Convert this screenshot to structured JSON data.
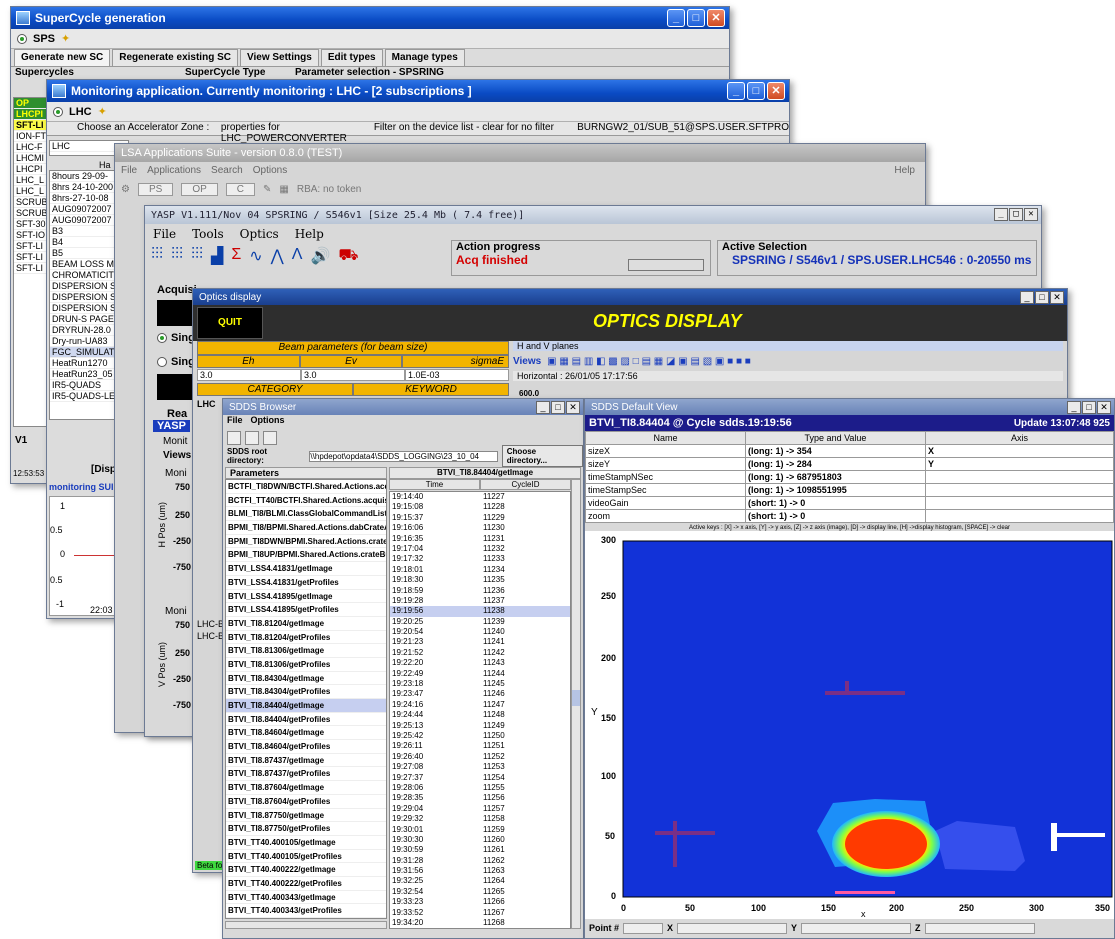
{
  "supercycle": {
    "title": "SuperCycle generation",
    "machine": "SPS",
    "tabs": [
      "Generate new SC",
      "Regenerate existing SC",
      "View Settings",
      "Edit types",
      "Manage types"
    ],
    "col1": "Supercycles",
    "col2": "SuperCycle Type",
    "col3": "Parameter selection - SPSRING",
    "rows": [
      "LHCPI",
      "SFT-LI",
      "ION-FT",
      "LHC-F",
      "LHCMI",
      "LHCPI",
      "LHC_L",
      "LHC_L",
      "SCRUB",
      "SCRUB",
      "SFT-30",
      "SFT-IO",
      "SFT-LI",
      "SFT-LI",
      "SFT-LI"
    ],
    "v1": "V1",
    "time": "12:53:53"
  },
  "monitoring": {
    "title": "Monitoring application. Currently monitoring : LHC - [2 subscriptions ]",
    "machine": "LHC",
    "header_zone": "Choose an Accelerator Zone :",
    "header_props": "properties for LHC_POWERCONVERTER",
    "header_filter": "Filter on the device list - clear for no filter",
    "header_device": "BURNGW2_01/SUB_51@SPS.USER.SFTPRO",
    "zone_value": "LHC",
    "ha_label": "Ha",
    "list": [
      "8hours 29-09-",
      "8hrs 24-10-200",
      "8hrs-27-10-08",
      "AUG09072007",
      "AUG09072007",
      "B3",
      "B4",
      "B5",
      "BEAM LOSS MC",
      "CHROMATICIT",
      "DISPERSION S",
      "DISPERSION S",
      "DISPERSION S",
      "DRUN-S PAGE",
      "DRYRUN-28.0",
      "Dry-run-UA83",
      "FGC_SIMULAT",
      "HeatRun1270",
      "HeatRun23_05",
      "IR5-QUADS",
      "IR5-QUADS-LE"
    ],
    "dispose": "[Disp",
    "subs_label": "monitoring SUI",
    "plot_time": "22:03",
    "yticks": [
      "1",
      "0.5",
      "0",
      "0.5",
      "-1"
    ]
  },
  "lsa": {
    "title": "LSA Applications Suite - version 0.8.0 (TEST)",
    "menu": [
      "File",
      "Applications",
      "Search",
      "Options"
    ],
    "help": "Help",
    "combo1": "PS",
    "combo2": "OP",
    "combo3": "C",
    "status": "RBA: no token"
  },
  "yasp": {
    "title": "YASP V1.111/Nov 04  SPSRING / S546v1  [Size 25.4 Mb ( 7.4 free)]",
    "menu": [
      "File",
      "Tools",
      "Optics",
      "Help"
    ],
    "action_label": "Action progress",
    "action_status": "Acq finished",
    "active_label": "Active Selection",
    "active_value": "SPSRING / S546v1 / SPS.USER.LHC546 : 0-20550 ms",
    "acq_label": "Acquisi",
    "sing1": "Sing",
    "sing2": "Sing",
    "rea": "Rea",
    "yasp_tab": "YASP",
    "monit": "Monit",
    "views": "Views",
    "moni1": "Moni",
    "moni2": "Moni",
    "h_axis": "H Pos (um)",
    "v_axis": "V Pos (um)",
    "h_ticks": [
      "750",
      "250",
      "-250",
      "-750"
    ],
    "v_ticks": [
      "750",
      "250",
      "-250",
      "-750"
    ]
  },
  "optics": {
    "title": "Optics display",
    "quit": "QUIT",
    "heading": "OPTICS DISPLAY",
    "beam_params": "Beam parameters (for beam size)",
    "eh": "Eh",
    "ev": "Ev",
    "sigmae": "sigmaE",
    "eh_val": "3.0",
    "ev_val": "3.0",
    "sigmae_val": "1.0E-03",
    "category": "CATEGORY",
    "keyword": "KEYWORD",
    "lhc": "LHC",
    "hv_planes": "H and V planes",
    "views": "Views",
    "horizontal": "Horizontal : 26/01/05 17:17:56",
    "val600": "600.0",
    "lhc_b1": "LHC-Be",
    "lhc_b2": "LHC-Be",
    "beta": "Beta fo"
  },
  "sdds_browser": {
    "title": "SDDS Browser",
    "menu": [
      "File",
      "Options"
    ],
    "root_label": "SDDS root directory:",
    "root_value": "\\\\hpdepot\\opdata4\\SDDS_LOGGING\\23_10_04",
    "choose_btn": "Choose directory...",
    "params_header": "Parameters",
    "right_header": "BTVI_TI8.84404/getImage",
    "time_header": "Time",
    "cycle_header": "CycleID",
    "params": [
      "BCTFI_TI8DWN/BCTFI.Shared.Actions.acquisit",
      "BCTFI_TT40/BCTFI.Shared.Actions.acquisition",
      "BLMI_TI8/BLMI.ClassGlobalCommandList.b",
      "BPMI_TI8/BPMI.Shared.Actions.dabCrateAver",
      "BPMI_TI8DWN/BPMI.Shared.Actions.crateBur",
      "BPMI_TI8UP/BPMI.Shared.Actions.crateBunct",
      "BTVI_LSS4.41831/getImage",
      "BTVI_LSS4.41831/getProfiles",
      "BTVI_LSS4.41895/getImage",
      "BTVI_LSS4.41895/getProfiles",
      "BTVI_TI8.81204/getImage",
      "BTVI_TI8.81204/getProfiles",
      "BTVI_TI8.81306/getImage",
      "BTVI_TI8.81306/getProfiles",
      "BTVI_TI8.84304/getImage",
      "BTVI_TI8.84304/getProfiles",
      "BTVI_TI8.84404/getImage",
      "BTVI_TI8.84404/getProfiles",
      "BTVI_TI8.84604/getImage",
      "BTVI_TI8.84604/getProfiles",
      "BTVI_TI8.87437/getImage",
      "BTVI_TI8.87437/getProfiles",
      "BTVI_TI8.87604/getImage",
      "BTVI_TI8.87604/getProfiles",
      "BTVI_TI8.87750/getImage",
      "BTVI_TI8.87750/getProfiles",
      "BTVI_TT40.400105/getImage",
      "BTVI_TT40.400105/getProfiles",
      "BTVI_TT40.400222/getImage",
      "BTVI_TT40.400222/getProfiles",
      "BTVI_TT40.400343/getImage",
      "BTVI_TT40.400343/getProfiles"
    ],
    "selected_param_index": 16,
    "times": [
      "19:14:40",
      "19:15:08",
      "19:15:37",
      "19:16:06",
      "19:16:35",
      "19:17:04",
      "19:17:32",
      "19:18:01",
      "19:18:30",
      "19:18:59",
      "19:19:28",
      "19:19:56",
      "19:20:25",
      "19:20:54",
      "19:21:23",
      "19:21:52",
      "19:22:20",
      "19:22:49",
      "19:23:18",
      "19:23:47",
      "19:24:16",
      "19:24:44",
      "19:25:13",
      "19:25:42",
      "19:26:11",
      "19:26:40",
      "19:27:08",
      "19:27:37",
      "19:28:06",
      "19:28:35",
      "19:29:04",
      "19:29:32",
      "19:30:01",
      "19:30:30",
      "19:30:59",
      "19:31:28",
      "19:31:56",
      "19:32:25",
      "19:32:54",
      "19:33:23",
      "19:33:52",
      "19:34:20"
    ],
    "cycles": [
      "11227",
      "11228",
      "11229",
      "11230",
      "11231",
      "11232",
      "11233",
      "11234",
      "11235",
      "11236",
      "11237",
      "11238",
      "11239",
      "11240",
      "11241",
      "11242",
      "11243",
      "11244",
      "11245",
      "11246",
      "11247",
      "11248",
      "11249",
      "11250",
      "11251",
      "11252",
      "11253",
      "11254",
      "11255",
      "11256",
      "11257",
      "11258",
      "11259",
      "11260",
      "11261",
      "11262",
      "11263",
      "11264",
      "11265",
      "11266",
      "11267",
      "11268"
    ],
    "selected_time_index": 11
  },
  "sdds_view": {
    "title": "SDDS Default View",
    "heading": "BTVI_TI8.84404 @ Cycle sdds.19:19:56",
    "update": "Update 13:07:48 925",
    "col_name": "Name",
    "col_type": "Type and Value",
    "col_axis": "Axis",
    "rows": [
      {
        "name": "sizeX",
        "value": "(long: 1) -> 354",
        "axis": "X"
      },
      {
        "name": "sizeY",
        "value": "(long: 1) -> 284",
        "axis": "Y"
      },
      {
        "name": "timeStampNSec",
        "value": "(long: 1) -> 687951803",
        "axis": ""
      },
      {
        "name": "timeStampSec",
        "value": "(long: 1) -> 1098551995",
        "axis": ""
      },
      {
        "name": "videoGain",
        "value": "(short: 1) -> 0",
        "axis": ""
      },
      {
        "name": "zoom",
        "value": "(short: 1) -> 0",
        "axis": ""
      }
    ],
    "active_keys": "Active keys : [X] -> x axis, [Y] -> y axis, [Z] -> z axis (image), [D] -> display line, [H] ->display histogram, [SPACE] -> clear",
    "y_axis_label": "Y",
    "x_axis_label": "x",
    "yticks": [
      "300",
      "250",
      "200",
      "150",
      "100",
      "50",
      "0"
    ],
    "xticks": [
      "0",
      "50",
      "100",
      "150",
      "200",
      "250",
      "300",
      "350"
    ],
    "point_label": "Point #",
    "x_field": "X",
    "y_field": "Y",
    "z_field": "Z"
  }
}
